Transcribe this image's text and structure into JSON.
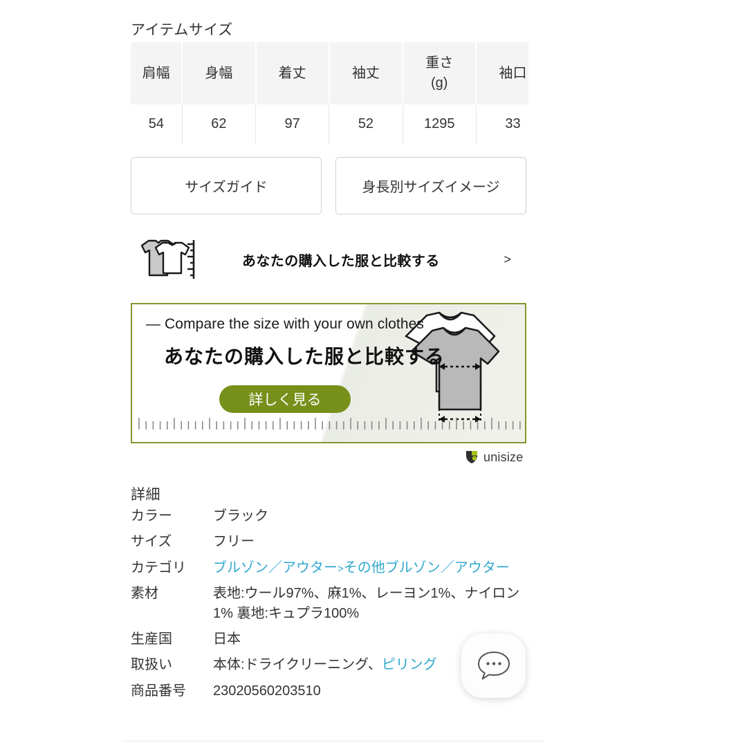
{
  "item_size": {
    "title": "アイテムサイズ",
    "columns": [
      "肩幅",
      "身幅",
      "着丈",
      "袖丈",
      "重さ\n(g)",
      "袖口"
    ],
    "values": [
      "54",
      "62",
      "97",
      "52",
      "1295",
      "33"
    ]
  },
  "buttons": {
    "size_guide": "サイズガイド",
    "height_size_image": "身長別サイズイメージ"
  },
  "compare_link": {
    "label": "あなたの購入した服と比較する",
    "chevron": ">",
    "icon": "two-tshirts-ruler-icon"
  },
  "banner": {
    "english_headline": "— Compare the size with your own clothes",
    "japanese_headline": "あなたの購入した服と比較する",
    "cta_label": "詳しく見る",
    "border_color": "#8a942f",
    "cta_color": "#77901a"
  },
  "unisize": {
    "brand": "unisize",
    "logo_green": "#a5c11a"
  },
  "details": {
    "title": "詳細",
    "rows": [
      {
        "label": "カラー",
        "value": "ブラック",
        "is_link": false
      },
      {
        "label": "サイズ",
        "value": "フリー",
        "is_link": false
      },
      {
        "label": "カテゴリ",
        "value": "ブルゾン／アウター",
        "value2": "その他ブルゾン／アウター",
        "separator": ">",
        "is_link": true
      },
      {
        "label": "素材",
        "value": "表地:ウール97%、麻1%、レーヨン1%、ナイロン1% 裏地:キュプラ100%",
        "is_link": false
      },
      {
        "label": "生産国",
        "value": "日本",
        "is_link": false
      },
      {
        "label": "取扱い",
        "value": "本体:ドライクリーニング、",
        "link_value": "ピリング",
        "is_link": false
      },
      {
        "label": "商品番号",
        "value": "23020560203510",
        "is_link": false
      }
    ],
    "link_color": "#31a8cd"
  },
  "chat": {
    "icon": "chat-bubble-icon",
    "aria": "チャット"
  }
}
